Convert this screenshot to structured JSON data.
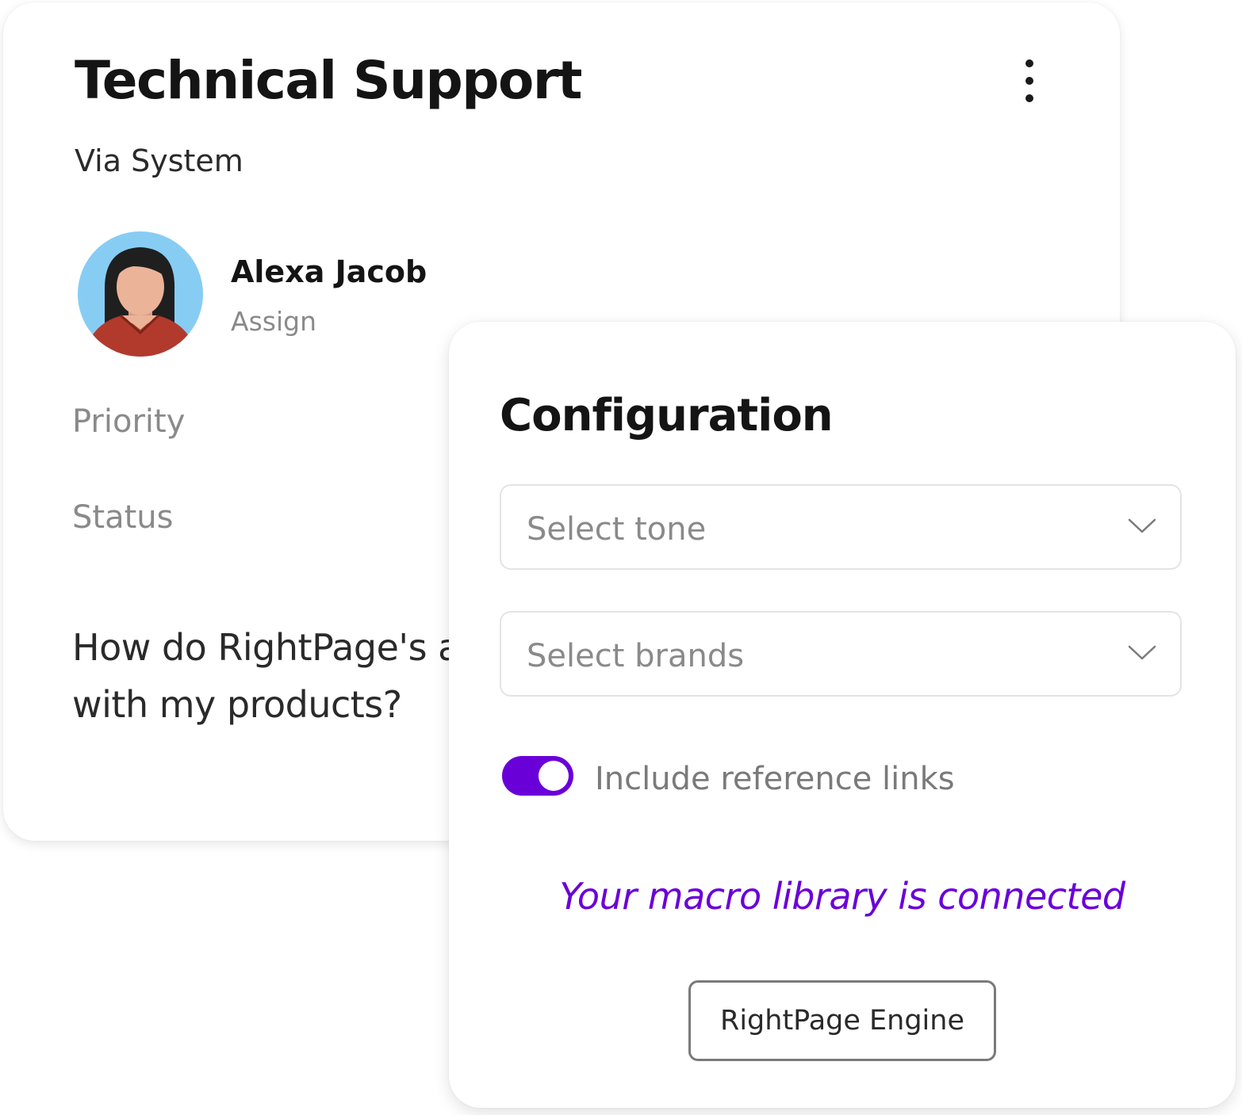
{
  "ticket": {
    "title": "Technical Support",
    "source": "Via System",
    "assignee": {
      "name": "Alexa Jacob",
      "assign_label": "Assign"
    },
    "fields": {
      "priority_label": "Priority",
      "status_label": "Status"
    },
    "question": "How do RightPage's as date with my products?",
    "menu_icon": "more-vertical-icon"
  },
  "configuration": {
    "title": "Configuration",
    "tone_select": {
      "placeholder": "Select tone",
      "icon": "chevron-down-icon"
    },
    "brands_select": {
      "placeholder": "Select brands",
      "icon": "chevron-down-icon"
    },
    "reference_links_toggle": {
      "label": "Include reference links",
      "on": true
    },
    "status_message": "Your macro library is connected",
    "engine_button_label": "RightPage Engine"
  },
  "colors": {
    "accent": "#6a00d8",
    "text_dark": "#141414",
    "text_muted": "#8a8a8a",
    "avatar_bg": "#87cdf3",
    "avatar_shirt": "#b23a2c",
    "avatar_skin": "#ebb398",
    "avatar_hair": "#1f1f1f"
  }
}
